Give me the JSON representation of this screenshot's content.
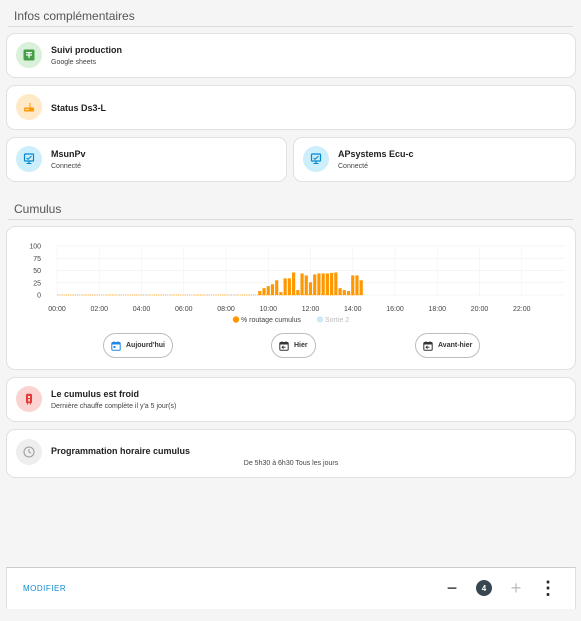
{
  "sections": {
    "infos_title": "Infos complémentaires",
    "cumulus_title": "Cumulus"
  },
  "cards": {
    "suivi": {
      "title": "Suivi production",
      "subtitle": "Google sheets",
      "icon": "spreadsheet-icon",
      "color": "#4caf50"
    },
    "status": {
      "title": "Status Ds3-L",
      "icon": "router-icon",
      "color": "#ff9800"
    },
    "msunpv": {
      "title": "MsunPv",
      "subtitle": "Connecté",
      "icon": "monitor-icon",
      "color": "#03a9f4"
    },
    "apsystems": {
      "title": "APsystems Ecu-c",
      "subtitle": "Connecté",
      "icon": "monitor-icon",
      "color": "#03a9f4"
    },
    "cumulus_state": {
      "title": "Le cumulus est froid",
      "subtitle": "Dernière chauffe complète il y'a 5 jour(s)",
      "icon": "water-heater-icon",
      "color": "#f44336"
    },
    "programmation": {
      "title": "Programmation horaire cumulus",
      "subtitle": "De 5h30 à 6h30 Tous les jours",
      "icon": "clock-icon",
      "color": "#9e9e9e"
    }
  },
  "chart_data": {
    "type": "bar",
    "xlim": [
      0,
      24
    ],
    "ylim": [
      0,
      100
    ],
    "x_ticks": [
      "00:00",
      "02:00",
      "04:00",
      "06:00",
      "08:00",
      "10:00",
      "12:00",
      "14:00",
      "16:00",
      "18:00",
      "20:00",
      "22:00"
    ],
    "y_ticks": [
      "100",
      "75",
      "50",
      "25",
      "0"
    ],
    "series": [
      {
        "name": "% routage cumulus",
        "color": "#ff9800",
        "points": [
          [
            9.6,
            8
          ],
          [
            9.8,
            14
          ],
          [
            10.0,
            18
          ],
          [
            10.2,
            22
          ],
          [
            10.4,
            30
          ],
          [
            10.6,
            6
          ],
          [
            10.8,
            34
          ],
          [
            11.0,
            34
          ],
          [
            11.2,
            46
          ],
          [
            11.4,
            10
          ],
          [
            11.6,
            44
          ],
          [
            11.8,
            40
          ],
          [
            12.0,
            26
          ],
          [
            12.2,
            42
          ],
          [
            12.4,
            44
          ],
          [
            12.6,
            44
          ],
          [
            12.8,
            44
          ],
          [
            13.0,
            45
          ],
          [
            13.2,
            46
          ],
          [
            13.4,
            14
          ],
          [
            13.6,
            10
          ],
          [
            13.8,
            8
          ],
          [
            14.0,
            40
          ],
          [
            14.2,
            40
          ],
          [
            14.4,
            30
          ]
        ]
      },
      {
        "name": "Sortie 2",
        "color": "#cfe8f5",
        "points": []
      }
    ],
    "baseline_color": "#ff9800"
  },
  "chart_buttons": {
    "today": "Aujourd'hui",
    "yesterday": "Hier",
    "before_yesterday": "Avant-hier"
  },
  "footer": {
    "modify_label": "MODIFIER",
    "count": "4",
    "minus": "−",
    "plus": "+",
    "more": "⋮"
  }
}
